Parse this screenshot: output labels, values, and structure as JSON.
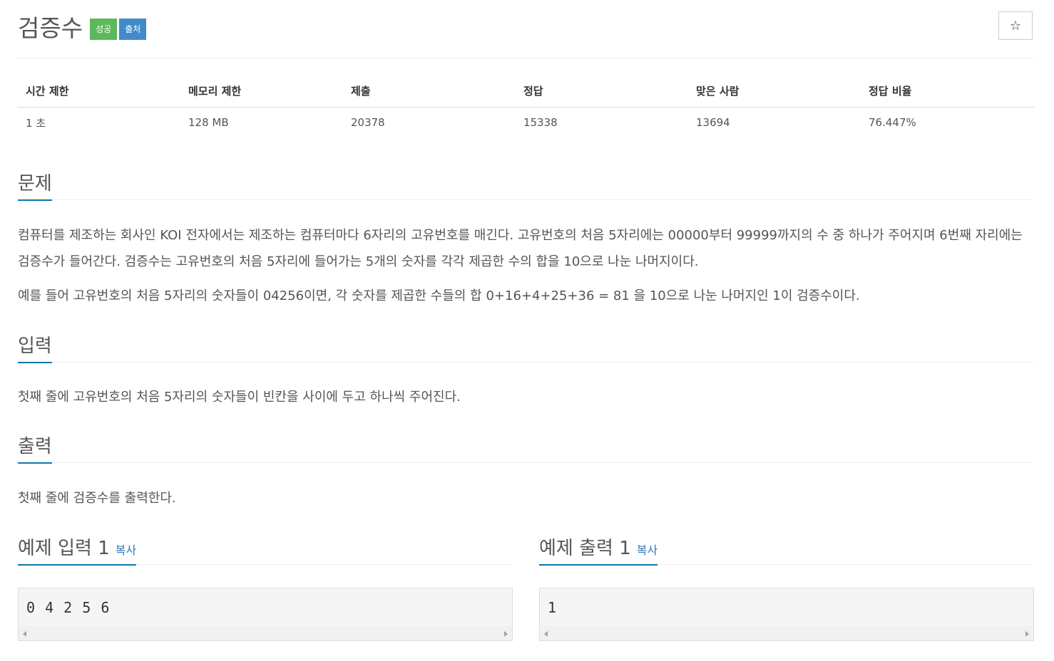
{
  "problem": {
    "title": "검증수",
    "badges": [
      "성공",
      "출처"
    ],
    "star_icon": "star-icon"
  },
  "stats": {
    "headers": [
      "시간 제한",
      "메모리 제한",
      "제출",
      "정답",
      "맞은 사람",
      "정답 비율"
    ],
    "values": [
      "1 초",
      "128 MB",
      "20378",
      "15338",
      "13694",
      "76.447%"
    ]
  },
  "sections": {
    "problem_heading": "문제",
    "problem_p1": "컴퓨터를 제조하는 회사인 KOI 전자에서는 제조하는 컴퓨터마다 6자리의 고유번호를 매긴다. 고유번호의 처음 5자리에는 00000부터 99999까지의 수 중 하나가 주어지며 6번째 자리에는 검증수가 들어간다. 검증수는 고유번호의 처음 5자리에 들어가는 5개의 숫자를 각각 제곱한 수의 합을 10으로 나눈 나머지이다.",
    "problem_p2": "예를 들어 고유번호의 처음 5자리의 숫자들이 04256이면, 각 숫자를 제곱한 수들의 합 0+16+4+25+36 = 81 을 10으로 나눈 나머지인 1이 검증수이다.",
    "input_heading": "입력",
    "input_text": "첫째 줄에 고유번호의 처음 5자리의 숫자들이 빈칸을 사이에 두고 하나씩 주어진다.",
    "output_heading": "출력",
    "output_text": "첫째 줄에 검증수를 출력한다."
  },
  "samples": {
    "input_heading": "예제 입력 1",
    "output_heading": "예제 출력 1",
    "copy_label": "복사",
    "input_value": "0 4 2 5 6",
    "output_value": "1"
  }
}
